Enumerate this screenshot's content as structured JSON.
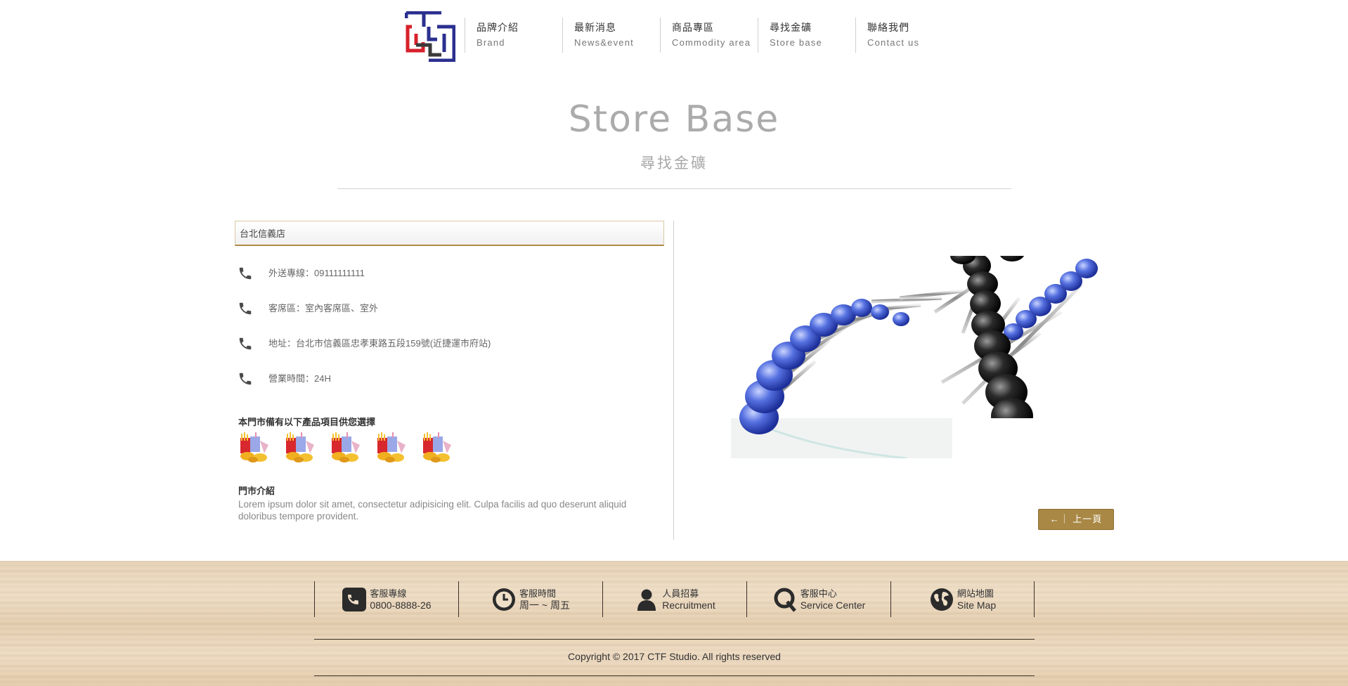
{
  "brand": {
    "logo_colors": [
      "#2b2f8f",
      "#d7202b",
      "#3a3a3a"
    ]
  },
  "nav": [
    {
      "zh": "品牌介紹",
      "en": "Brand"
    },
    {
      "zh": "最新消息",
      "en": "News&event"
    },
    {
      "zh": "商品專區",
      "en": "Commodity area"
    },
    {
      "zh": "尋找金礦",
      "en": "Store base"
    },
    {
      "zh": "聯絡我們",
      "en": "Contact us"
    }
  ],
  "page": {
    "title": "Store Base",
    "subtitle": "尋找金礦"
  },
  "store": {
    "name": "台北信義店",
    "info": [
      {
        "icon": "phone-icon",
        "text": "外送專線：09111111111"
      },
      {
        "icon": "phone-icon",
        "text": "客席區：室內客席區、室外"
      },
      {
        "icon": "phone-icon",
        "text": "地址：台北市信義區忠孝東路五段159號(近捷運市府站)"
      },
      {
        "icon": "phone-icon",
        "text": "營業時間：24H"
      }
    ],
    "products_title": "本門市備有以下產品項目供您選擇",
    "products_count": 5,
    "intro_title": "門市介紹",
    "intro_text": "Lorem ipsum dolor sit amet, consectetur adipisicing elit. Culpa facilis ad quo deserunt aliquid doloribus tempore provident."
  },
  "back_button": {
    "label": "←｜ 上一頁"
  },
  "footer": {
    "items": [
      {
        "icon": "phone-icon",
        "line1": "客服專線",
        "line2": "0800-8888-26"
      },
      {
        "icon": "clock-icon",
        "line1": "客服時間",
        "line2": "周一 ~ 周五"
      },
      {
        "icon": "person-icon",
        "line1": "人員招募",
        "line2": "Recruitment"
      },
      {
        "icon": "q-icon",
        "line1": "客服中心",
        "line2": "Service Center"
      },
      {
        "icon": "globe-icon",
        "line1": "網站地圖",
        "line2": "Site Map"
      }
    ],
    "copyright": "Copyright © 2017 CTF Studio. All rights reserved"
  },
  "colors": {
    "accent": "#a98845",
    "accent_border": "#b08a45",
    "footer_text": "#333333"
  }
}
